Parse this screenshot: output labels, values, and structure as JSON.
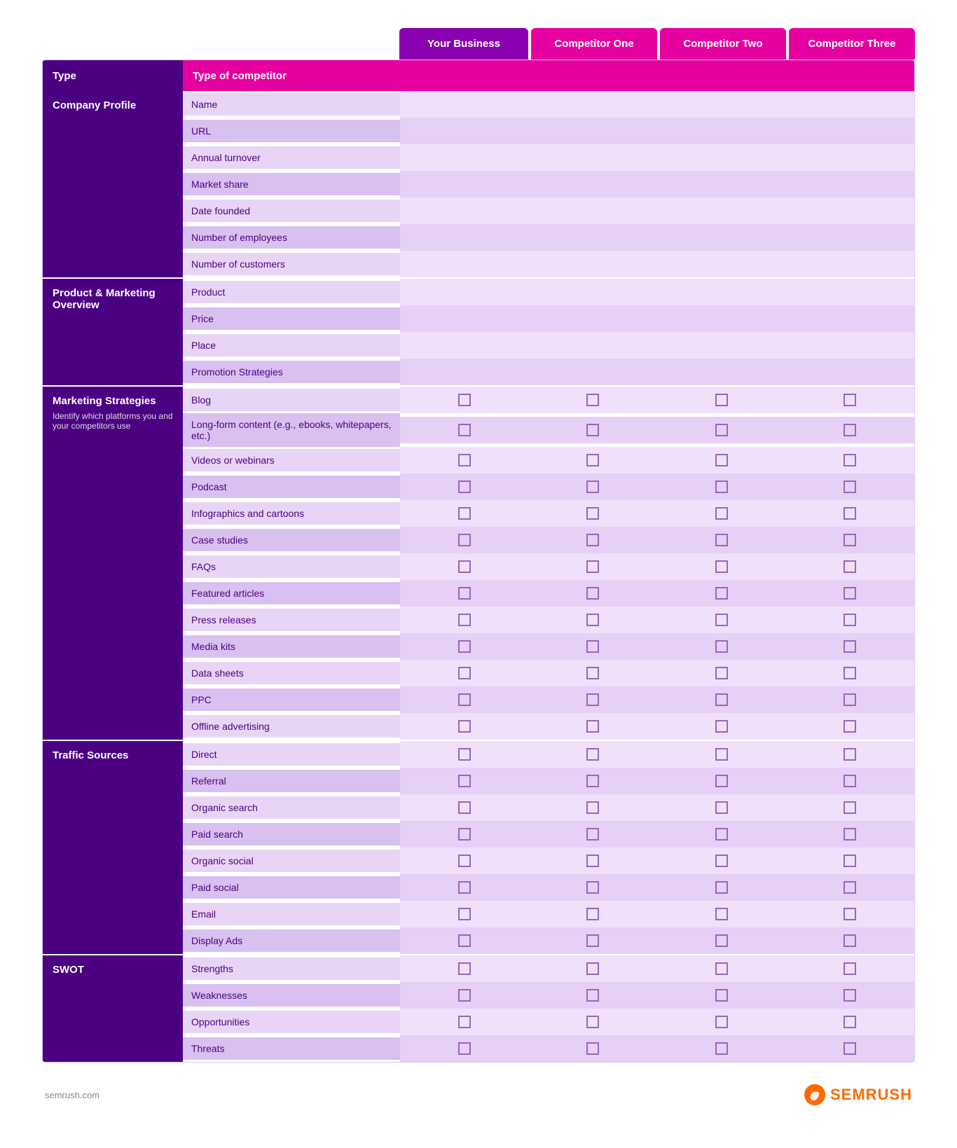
{
  "header": {
    "col1": "",
    "col2": "",
    "your_business": "Your Business",
    "competitor_one": "Competitor One",
    "competitor_two": "Competitor Two",
    "competitor_three": "Competitor Three"
  },
  "type_row": {
    "left": "Type",
    "label": "Type of competitor"
  },
  "sections": [
    {
      "id": "company",
      "label": "Company Profile",
      "sublabel": "",
      "rows": [
        {
          "label": "Name"
        },
        {
          "label": "URL"
        },
        {
          "label": "Annual turnover"
        },
        {
          "label": "Market share"
        },
        {
          "label": "Date founded"
        },
        {
          "label": "Number of employees"
        },
        {
          "label": "Number of customers"
        }
      ],
      "has_checkboxes": false
    },
    {
      "id": "product",
      "label": "Product & Marketing Overview",
      "sublabel": "",
      "rows": [
        {
          "label": "Product"
        },
        {
          "label": "Price"
        },
        {
          "label": "Place"
        },
        {
          "label": "Promotion Strategies"
        }
      ],
      "has_checkboxes": false
    },
    {
      "id": "marketing",
      "label": "Marketing Strategies",
      "sublabel": "Identify which platforms you and your competitors use",
      "rows": [
        {
          "label": "Blog"
        },
        {
          "label": "Long-form content (e.g., ebooks, whitepapers, etc.)"
        },
        {
          "label": "Videos or webinars"
        },
        {
          "label": "Podcast"
        },
        {
          "label": "Infographics and cartoons"
        },
        {
          "label": "Case studies"
        },
        {
          "label": "FAQs"
        },
        {
          "label": "Featured articles"
        },
        {
          "label": "Press releases"
        },
        {
          "label": "Media kits"
        },
        {
          "label": "Data sheets"
        },
        {
          "label": "PPC"
        },
        {
          "label": "Offline advertising"
        }
      ],
      "has_checkboxes": true
    },
    {
      "id": "traffic",
      "label": "Traffic Sources",
      "sublabel": "",
      "rows": [
        {
          "label": "Direct"
        },
        {
          "label": "Referral"
        },
        {
          "label": "Organic search"
        },
        {
          "label": "Paid search"
        },
        {
          "label": "Organic social"
        },
        {
          "label": "Paid social"
        },
        {
          "label": "Email"
        },
        {
          "label": "Display Ads"
        }
      ],
      "has_checkboxes": true
    },
    {
      "id": "swot",
      "label": "SWOT",
      "sublabel": "",
      "rows": [
        {
          "label": "Strengths"
        },
        {
          "label": "Weaknesses"
        },
        {
          "label": "Opportunities"
        },
        {
          "label": "Threats"
        }
      ],
      "has_checkboxes": true
    }
  ],
  "footer": {
    "website": "semrush.com",
    "brand": "SEMRUSH"
  }
}
